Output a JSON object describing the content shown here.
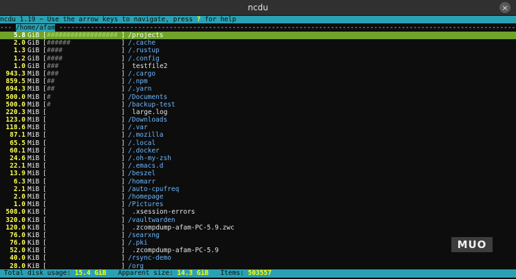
{
  "window": {
    "title": "ncdu"
  },
  "header": {
    "text_before_key": "ncdu 1.19 ~ Use the arrow keys to navigate, press ",
    "help_key": "?",
    "text_after_key": " for help"
  },
  "path_line": {
    "prefix": "--- ",
    "path": "/home/afam",
    "suffix": " ------------------------------------------------------------------------------------------------------------------------------------------"
  },
  "entries": [
    {
      "size": "5.8",
      "unit": "GiB",
      "graph": "##################",
      "name": "/projects",
      "kind": "dir",
      "selected": true
    },
    {
      "size": "2.0",
      "unit": "GiB",
      "graph": "######",
      "name": "/.cache",
      "kind": "dir"
    },
    {
      "size": "1.3",
      "unit": "GiB",
      "graph": "####",
      "name": "/.rustup",
      "kind": "dir"
    },
    {
      "size": "1.2",
      "unit": "GiB",
      "graph": "####",
      "name": "/.config",
      "kind": "dir"
    },
    {
      "size": "1.0",
      "unit": "GiB",
      "graph": "###",
      "name": "testfile2",
      "kind": "file"
    },
    {
      "size": "943.3",
      "unit": "MiB",
      "graph": "###",
      "name": "/.cargo",
      "kind": "dir"
    },
    {
      "size": "859.5",
      "unit": "MiB",
      "graph": "##",
      "name": "/.npm",
      "kind": "dir"
    },
    {
      "size": "694.3",
      "unit": "MiB",
      "graph": "##",
      "name": "/.yarn",
      "kind": "dir"
    },
    {
      "size": "500.0",
      "unit": "MiB",
      "graph": "#",
      "name": "/Documents",
      "kind": "dir"
    },
    {
      "size": "500.0",
      "unit": "MiB",
      "graph": "#",
      "name": "/backup-test",
      "kind": "dir"
    },
    {
      "size": "220.3",
      "unit": "MiB",
      "graph": "",
      "name": "large.log",
      "kind": "file"
    },
    {
      "size": "123.0",
      "unit": "MiB",
      "graph": "",
      "name": "/Downloads",
      "kind": "dir"
    },
    {
      "size": "118.6",
      "unit": "MiB",
      "graph": "",
      "name": "/.var",
      "kind": "dir"
    },
    {
      "size": "87.1",
      "unit": "MiB",
      "graph": "",
      "name": "/.mozilla",
      "kind": "dir"
    },
    {
      "size": "65.5",
      "unit": "MiB",
      "graph": "",
      "name": "/.local",
      "kind": "dir"
    },
    {
      "size": "60.1",
      "unit": "MiB",
      "graph": "",
      "name": "/.docker",
      "kind": "dir"
    },
    {
      "size": "24.6",
      "unit": "MiB",
      "graph": "",
      "name": "/.oh-my-zsh",
      "kind": "dir"
    },
    {
      "size": "22.1",
      "unit": "MiB",
      "graph": "",
      "name": "/.emacs.d",
      "kind": "dir"
    },
    {
      "size": "13.9",
      "unit": "MiB",
      "graph": "",
      "name": "/beszel",
      "kind": "dir"
    },
    {
      "size": "6.3",
      "unit": "MiB",
      "graph": "",
      "name": "/homarr",
      "kind": "dir"
    },
    {
      "size": "2.1",
      "unit": "MiB",
      "graph": "",
      "name": "/auto-cpufreq",
      "kind": "dir"
    },
    {
      "size": "2.0",
      "unit": "MiB",
      "graph": "",
      "name": "/homepage",
      "kind": "dir"
    },
    {
      "size": "1.0",
      "unit": "MiB",
      "graph": "",
      "name": "/Pictures",
      "kind": "dir"
    },
    {
      "size": "508.0",
      "unit": "KiB",
      "graph": "",
      "name": ".xsession-errors",
      "kind": "file"
    },
    {
      "size": "320.0",
      "unit": "KiB",
      "graph": "",
      "name": "/vaultwarden",
      "kind": "dir"
    },
    {
      "size": "120.0",
      "unit": "KiB",
      "graph": "",
      "name": ".zcompdump-afam-PC-5.9.zwc",
      "kind": "file"
    },
    {
      "size": "76.0",
      "unit": "KiB",
      "graph": "",
      "name": "/searxng",
      "kind": "dir"
    },
    {
      "size": "76.0",
      "unit": "KiB",
      "graph": "",
      "name": "/.pki",
      "kind": "dir"
    },
    {
      "size": "52.0",
      "unit": "KiB",
      "graph": "",
      "name": ".zcompdump-afam-PC-5.9",
      "kind": "file"
    },
    {
      "size": "40.0",
      "unit": "KiB",
      "graph": "",
      "name": "/rsync-demo",
      "kind": "dir"
    },
    {
      "size": "28.0",
      "unit": "KiB",
      "graph": "",
      "name": "/org",
      "kind": "dir"
    }
  ],
  "status_bar": {
    "disk_usage_label": " Total disk usage: ",
    "disk_usage_value": "15.4 GiB",
    "apparent_size_label": "   Apparent size: ",
    "apparent_size_value": "14.3 GiB",
    "items_label": "   Items: ",
    "items_value": "503557"
  },
  "watermark": {
    "text": "MUO"
  },
  "colors": {
    "header_bg": "#2aa1b3",
    "selected_row_bg": "#6fa32a",
    "size_text": "#ffff55",
    "dir_text": "#6cb7ff"
  }
}
